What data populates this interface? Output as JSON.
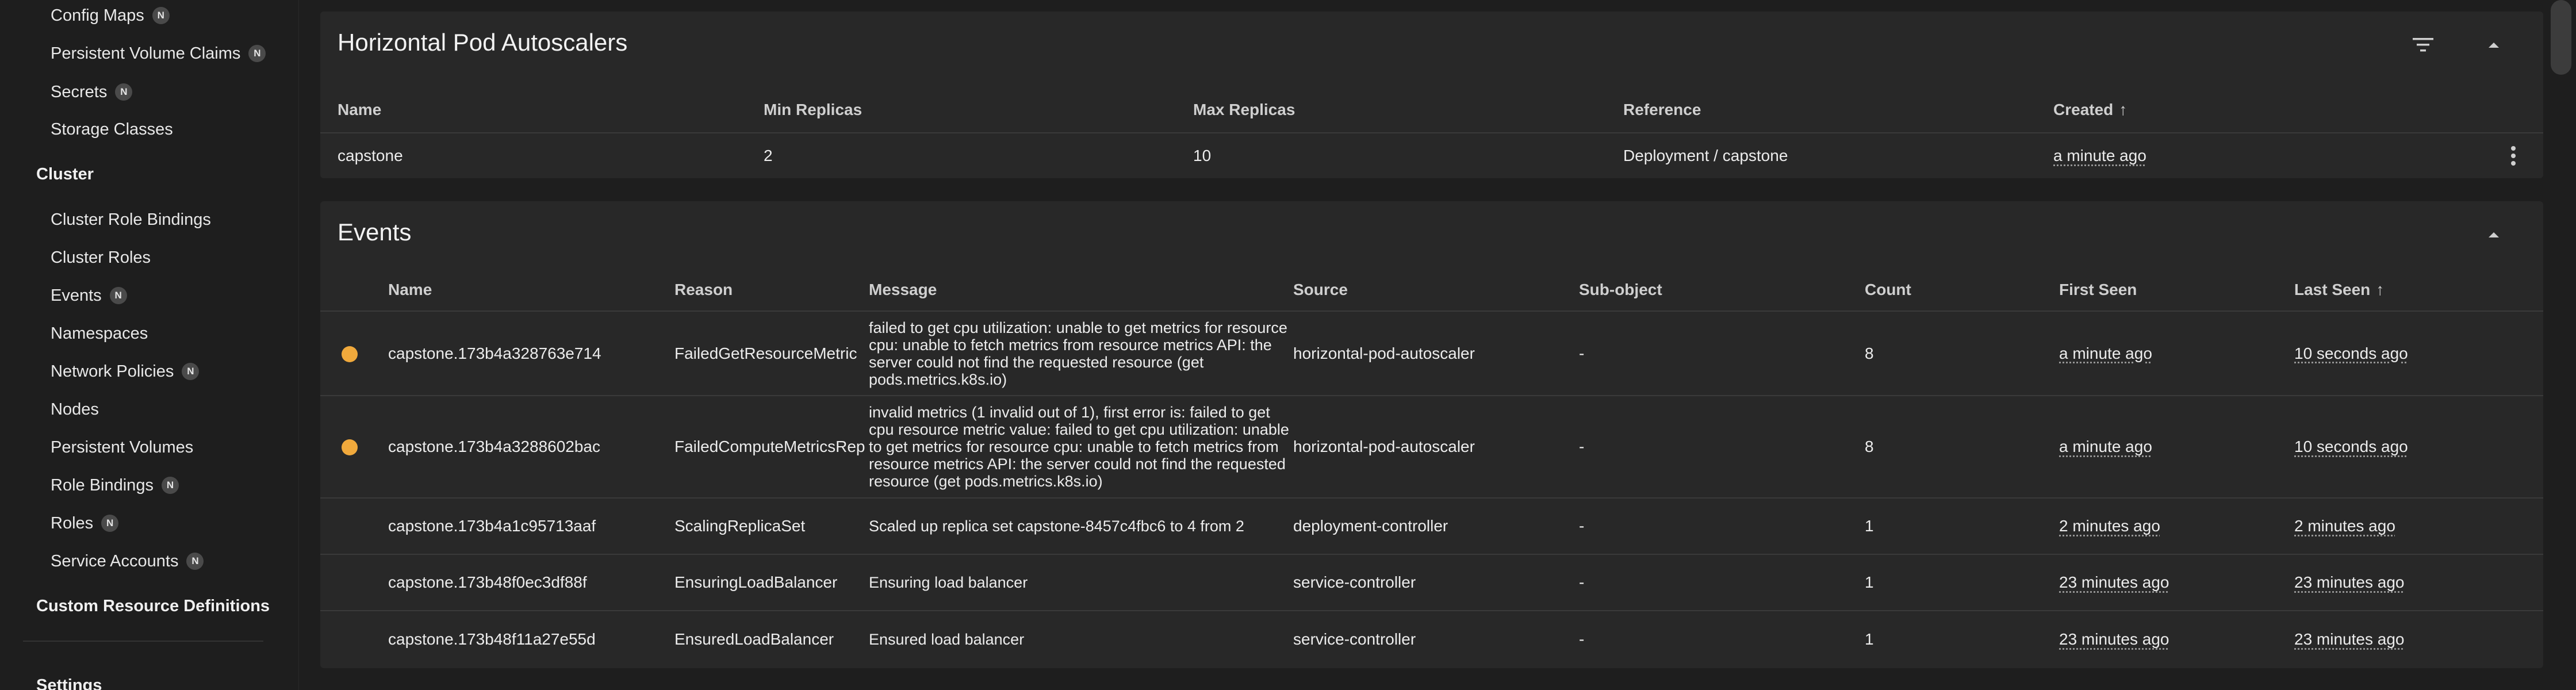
{
  "sidebar": {
    "items_top": [
      {
        "label": "Config Maps",
        "badge": "N"
      },
      {
        "label": "Persistent Volume Claims",
        "badge": "N"
      },
      {
        "label": "Secrets",
        "badge": "N"
      },
      {
        "label": "Storage Classes",
        "badge": ""
      }
    ],
    "cluster_header": "Cluster",
    "cluster_items": [
      {
        "label": "Cluster Role Bindings",
        "badge": ""
      },
      {
        "label": "Cluster Roles",
        "badge": ""
      },
      {
        "label": "Events",
        "badge": "N"
      },
      {
        "label": "Namespaces",
        "badge": ""
      },
      {
        "label": "Network Policies",
        "badge": "N"
      },
      {
        "label": "Nodes",
        "badge": ""
      },
      {
        "label": "Persistent Volumes",
        "badge": ""
      },
      {
        "label": "Role Bindings",
        "badge": "N"
      },
      {
        "label": "Roles",
        "badge": "N"
      },
      {
        "label": "Service Accounts",
        "badge": "N"
      }
    ],
    "crd_header": "Custom Resource Definitions",
    "settings_header": "Settings"
  },
  "hpa": {
    "title": "Horizontal Pod Autoscalers",
    "columns": [
      "Name",
      "Min Replicas",
      "Max Replicas",
      "Reference",
      "Created"
    ],
    "sorted_indicator": "↑",
    "rows": [
      {
        "name": "capstone",
        "min": "2",
        "max": "10",
        "reference": "Deployment / capstone",
        "created": "a minute ago"
      }
    ]
  },
  "events": {
    "title": "Events",
    "columns": [
      "Name",
      "Reason",
      "Message",
      "Source",
      "Sub-object",
      "Count",
      "First Seen",
      "Last Seen"
    ],
    "sorted_indicator": "↑",
    "warning_color": "#f0a93c",
    "rows": [
      {
        "warning": true,
        "name": "capstone.173b4a328763e714",
        "reason": "FailedGetResourceMetric",
        "message": "failed to get cpu utilization: unable to get metrics for resource cpu: unable to fetch metrics from resource metrics API: the server could not find the requested resource (get pods.metrics.k8s.io)",
        "source": "horizontal-pod-autoscaler",
        "subobject": "-",
        "count": "8",
        "first": "a minute ago",
        "last": "10 seconds ago"
      },
      {
        "warning": true,
        "name": "capstone.173b4a3288602bac",
        "reason": "FailedComputeMetricsRep",
        "message": "invalid metrics (1 invalid out of 1), first error is: failed to get cpu resource metric value: failed to get cpu utilization: unable to get metrics for resource cpu: unable to fetch metrics from resource metrics API: the server could not find the requested resource (get pods.metrics.k8s.io)",
        "source": "horizontal-pod-autoscaler",
        "subobject": "-",
        "count": "8",
        "first": "a minute ago",
        "last": "10 seconds ago"
      },
      {
        "warning": false,
        "name": "capstone.173b4a1c95713aaf",
        "reason": "ScalingReplicaSet",
        "message": "Scaled up replica set capstone-8457c4fbc6 to 4 from 2",
        "source": "deployment-controller",
        "subobject": "-",
        "count": "1",
        "first": "2 minutes ago",
        "last": "2 minutes ago"
      },
      {
        "warning": false,
        "name": "capstone.173b48f0ec3df88f",
        "reason": "EnsuringLoadBalancer",
        "message": "Ensuring load balancer",
        "source": "service-controller",
        "subobject": "-",
        "count": "1",
        "first": "23 minutes ago",
        "last": "23 minutes ago"
      },
      {
        "warning": false,
        "name": "capstone.173b48f11a27e55d",
        "reason": "EnsuredLoadBalancer",
        "message": "Ensured load balancer",
        "source": "service-controller",
        "subobject": "-",
        "count": "1",
        "first": "23 minutes ago",
        "last": "23 minutes ago"
      }
    ]
  }
}
